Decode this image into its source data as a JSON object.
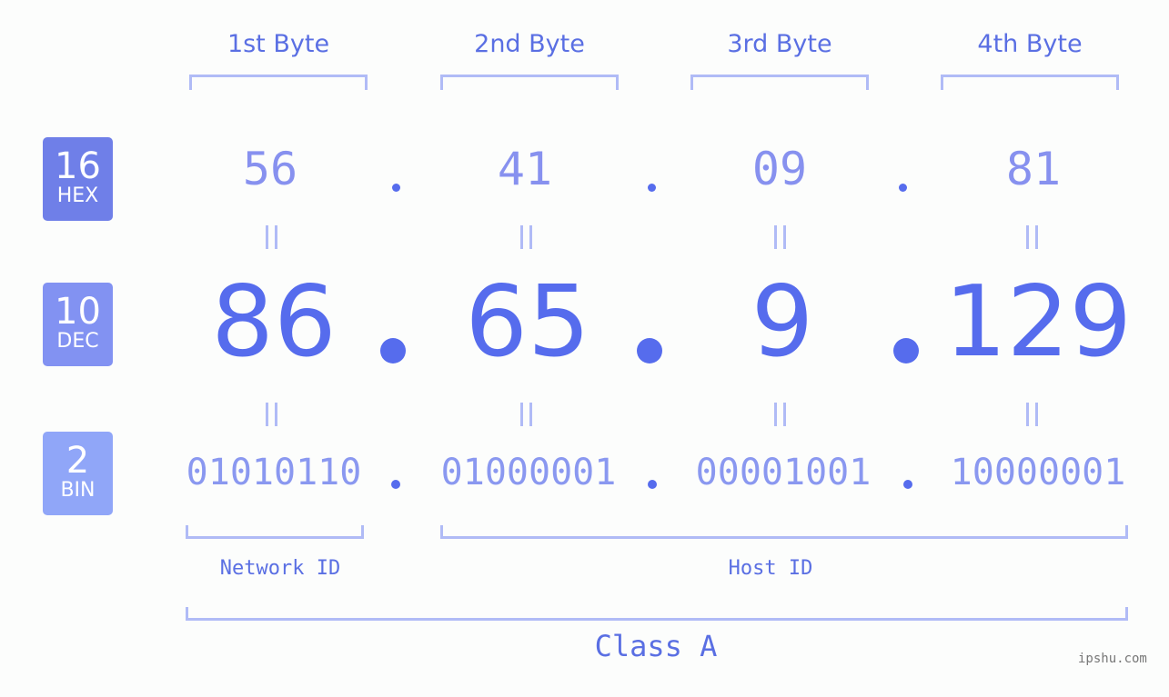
{
  "bytes": {
    "headers": [
      "1st Byte",
      "2nd Byte",
      "3rd Byte",
      "4th Byte"
    ]
  },
  "badges": {
    "hex": {
      "number": "16",
      "label": "HEX",
      "color": "#6f7fe8"
    },
    "dec": {
      "number": "10",
      "label": "DEC",
      "color": "#8292f2"
    },
    "bin": {
      "number": "2",
      "label": "BIN",
      "color": "#90a6f8"
    }
  },
  "hex_values": [
    "56",
    "41",
    "09",
    "81"
  ],
  "dec_values": [
    "86",
    "65",
    "9",
    "129"
  ],
  "bin_values": [
    "01010110",
    "01000001",
    "00001001",
    "10000001"
  ],
  "separator": ".",
  "network_id_label": "Network ID",
  "host_id_label": "Host ID",
  "class_label": "Class A",
  "watermark": "ipshu.com",
  "colors": {
    "accent": "#566ced",
    "bracket": "#b0bbf6",
    "label": "#5a6fe3"
  }
}
